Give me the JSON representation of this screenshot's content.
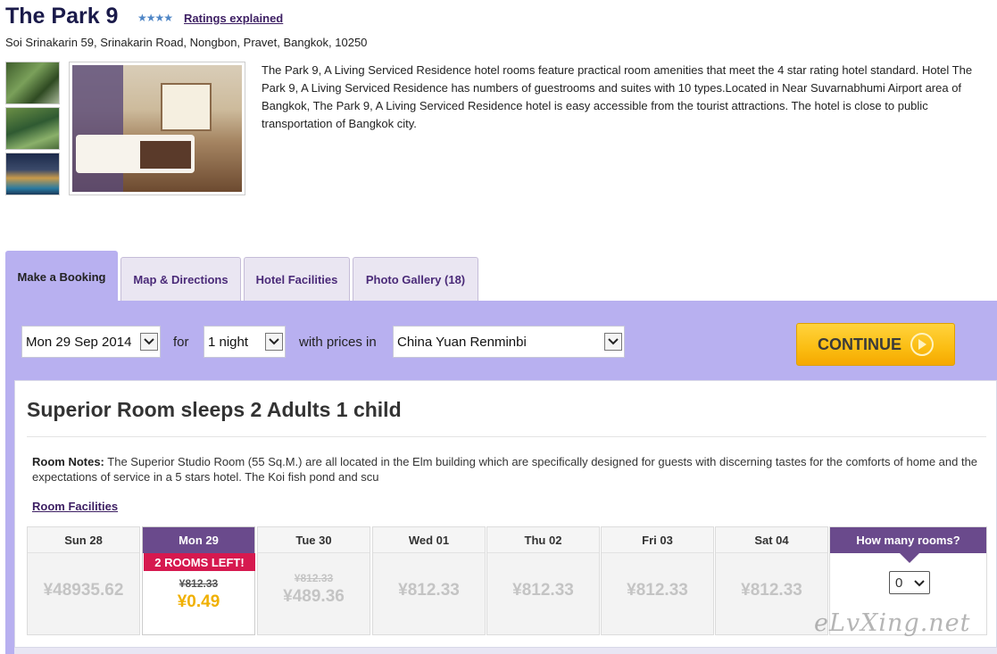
{
  "hotel": {
    "name": "The Park 9",
    "stars": "★★★★",
    "ratings_link": "Ratings explained",
    "address": "Soi Srinakarin 59, Srinakarin Road, Nongbon, Pravet, Bangkok, 10250",
    "description": "The Park 9, A Living Serviced Residence hotel rooms feature practical room amenities that meet the 4 star rating hotel standard. Hotel The Park 9, A Living Serviced Residence has numbers of guestrooms and suites with 10 types.Located in Near Suvarnabhumi Airport area of Bangkok, The Park 9, A Living Serviced Residence hotel is easy accessible from the tourist attractions. The hotel is close to public transportation of Bangkok city."
  },
  "tabs": [
    {
      "label": "Make a Booking",
      "active": true
    },
    {
      "label": "Map & Directions",
      "active": false
    },
    {
      "label": "Hotel Facilities",
      "active": false
    },
    {
      "label": "Photo Gallery (18)",
      "active": false
    }
  ],
  "booking": {
    "date": "Mon 29 Sep 2014",
    "for_label": "for",
    "nights": "1 night",
    "with_prices_label": "with prices in",
    "currency": "China Yuan Renminbi",
    "continue_label": "CONTINUE"
  },
  "room": {
    "title": "Superior Room sleeps 2 Adults 1 child",
    "notes_label": "Room Notes:",
    "notes_text": " The Superior Studio Room (55 Sq.M.) are all located in the Elm building which are specifically designed for guests with discerning tastes for the comforts of home and the expectations of service in a 5 stars hotel. The Koi fish pond and scu",
    "facilities_link": "Room Facilities"
  },
  "calendar": {
    "days": [
      {
        "label": "Sun 28",
        "price": "¥48935.62"
      },
      {
        "label": "Mon 29",
        "badge": "2 ROOMS LEFT!",
        "old_price": "¥812.33",
        "price": "¥0.49"
      },
      {
        "label": "Tue 30",
        "old_price": "¥812.33",
        "price": "¥489.36"
      },
      {
        "label": "Wed 01",
        "price": "¥812.33"
      },
      {
        "label": "Thu 02",
        "price": "¥812.33"
      },
      {
        "label": "Fri 03",
        "price": "¥812.33"
      },
      {
        "label": "Sat 04",
        "price": "¥812.33"
      }
    ],
    "rooms_heading": "How many rooms?",
    "rooms_value": "0"
  },
  "watermark": "eLvXing.net",
  "colors": {
    "panel": "#b8b0f0",
    "tab_active_text": "#222222",
    "header_purple": "#6a4a8c",
    "badge_red": "#d6194f",
    "deal_price": "#f0b000",
    "tue_price": "#c4c4c4",
    "continue_yellow": "#fbbd12"
  }
}
